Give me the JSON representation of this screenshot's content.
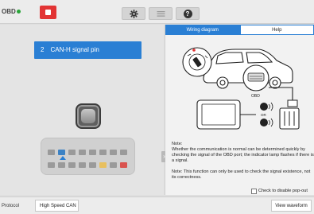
{
  "topbar": {
    "logo_text": "OBD",
    "stop_button": "stop-icon",
    "buttons": [
      {
        "icon": "gear-icon"
      },
      {
        "icon": "document-icon"
      },
      {
        "icon": "help-icon",
        "glyph": "?"
      }
    ]
  },
  "left": {
    "pin_number": "2",
    "pin_label": "CAN-H signal pin",
    "indicator_state": "off",
    "highlighted_pin": 2
  },
  "right": {
    "tabs": [
      {
        "label": "Wiring diagram",
        "active": true
      },
      {
        "label": "Help",
        "active": false
      }
    ],
    "diagram": {
      "obd_label": "OBD",
      "or_label": "OR"
    },
    "note_title": "Note:",
    "note_line1": "Whether the communication is normal can be determined quickly by checking the signal of the OBD port; the indicator lamp flashes if there is a signal.",
    "note_line2": "Note: This function can only be used to check the signal existence, not its correctness.",
    "disable_popup_label": "Check to disable pop-out",
    "disable_popup_checked": false
  },
  "bottom": {
    "protocol_label": "Protocol",
    "protocol_value": "High Speed CAN",
    "view_waveform": "View waveform"
  },
  "colors": {
    "accent": "#2a7fd4",
    "stop": "#e23434",
    "obd_dot": "#2aa53a"
  }
}
